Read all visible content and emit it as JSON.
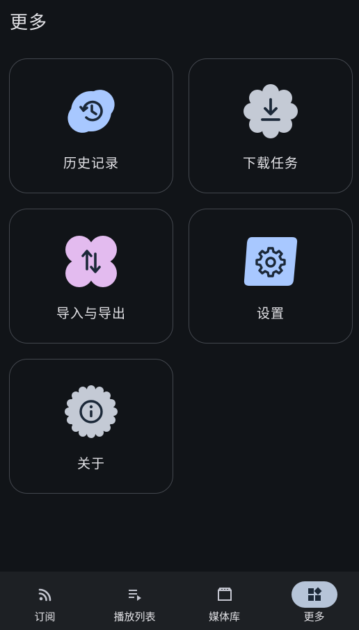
{
  "page": {
    "title": "更多"
  },
  "colors": {
    "background": "#111418",
    "card_border": "#43474e",
    "text": "#e2e2e6",
    "history_shape": "#a8c8ff",
    "download_shape": "#c4cad5",
    "import_export_shape": "#e3bbef",
    "settings_shape": "#a8c8ff",
    "about_shape": "#c4cad5",
    "icon_ink": "#1b2838",
    "nav_background": "#1d2024",
    "nav_active_pill": "#b6c4d8"
  },
  "menu": [
    {
      "label": "历史记录",
      "icon": "history-icon"
    },
    {
      "label": "下载任务",
      "icon": "download-icon"
    },
    {
      "label": "导入与导出",
      "icon": "import-export-icon"
    },
    {
      "label": "设置",
      "icon": "settings-icon"
    },
    {
      "label": "关于",
      "icon": "info-icon"
    }
  ],
  "nav": [
    {
      "label": "订阅",
      "icon": "rss-icon",
      "active": false
    },
    {
      "label": "播放列表",
      "icon": "playlist-icon",
      "active": false
    },
    {
      "label": "媒体库",
      "icon": "media-library-icon",
      "active": false
    },
    {
      "label": "更多",
      "icon": "more-widgets-icon",
      "active": true
    }
  ]
}
